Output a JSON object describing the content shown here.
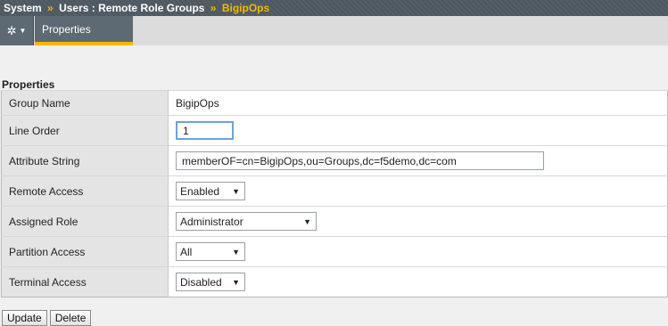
{
  "breadcrumb": {
    "root": "System",
    "parent": "Users : Remote Role Groups",
    "current": "BigipOps",
    "separator": "»"
  },
  "tabs": {
    "menu_icon": "gear-icon",
    "active": "Properties"
  },
  "section": {
    "title": "Properties"
  },
  "form": {
    "group_name": {
      "label": "Group Name",
      "value": "BigipOps"
    },
    "line_order": {
      "label": "Line Order",
      "value": "1"
    },
    "attribute_string": {
      "label": "Attribute String",
      "value": "memberOF=cn=BigipOps,ou=Groups,dc=f5demo,dc=com"
    },
    "remote_access": {
      "label": "Remote Access",
      "value": "Enabled"
    },
    "assigned_role": {
      "label": "Assigned Role",
      "value": "Administrator"
    },
    "partition_access": {
      "label": "Partition Access",
      "value": "All"
    },
    "terminal_access": {
      "label": "Terminal Access",
      "value": "Disabled"
    }
  },
  "buttons": {
    "update": "Update",
    "delete": "Delete"
  },
  "colors": {
    "accent": "#f5b800",
    "header_bg": "#4e5a63",
    "tab_bg": "#5d6a73"
  }
}
